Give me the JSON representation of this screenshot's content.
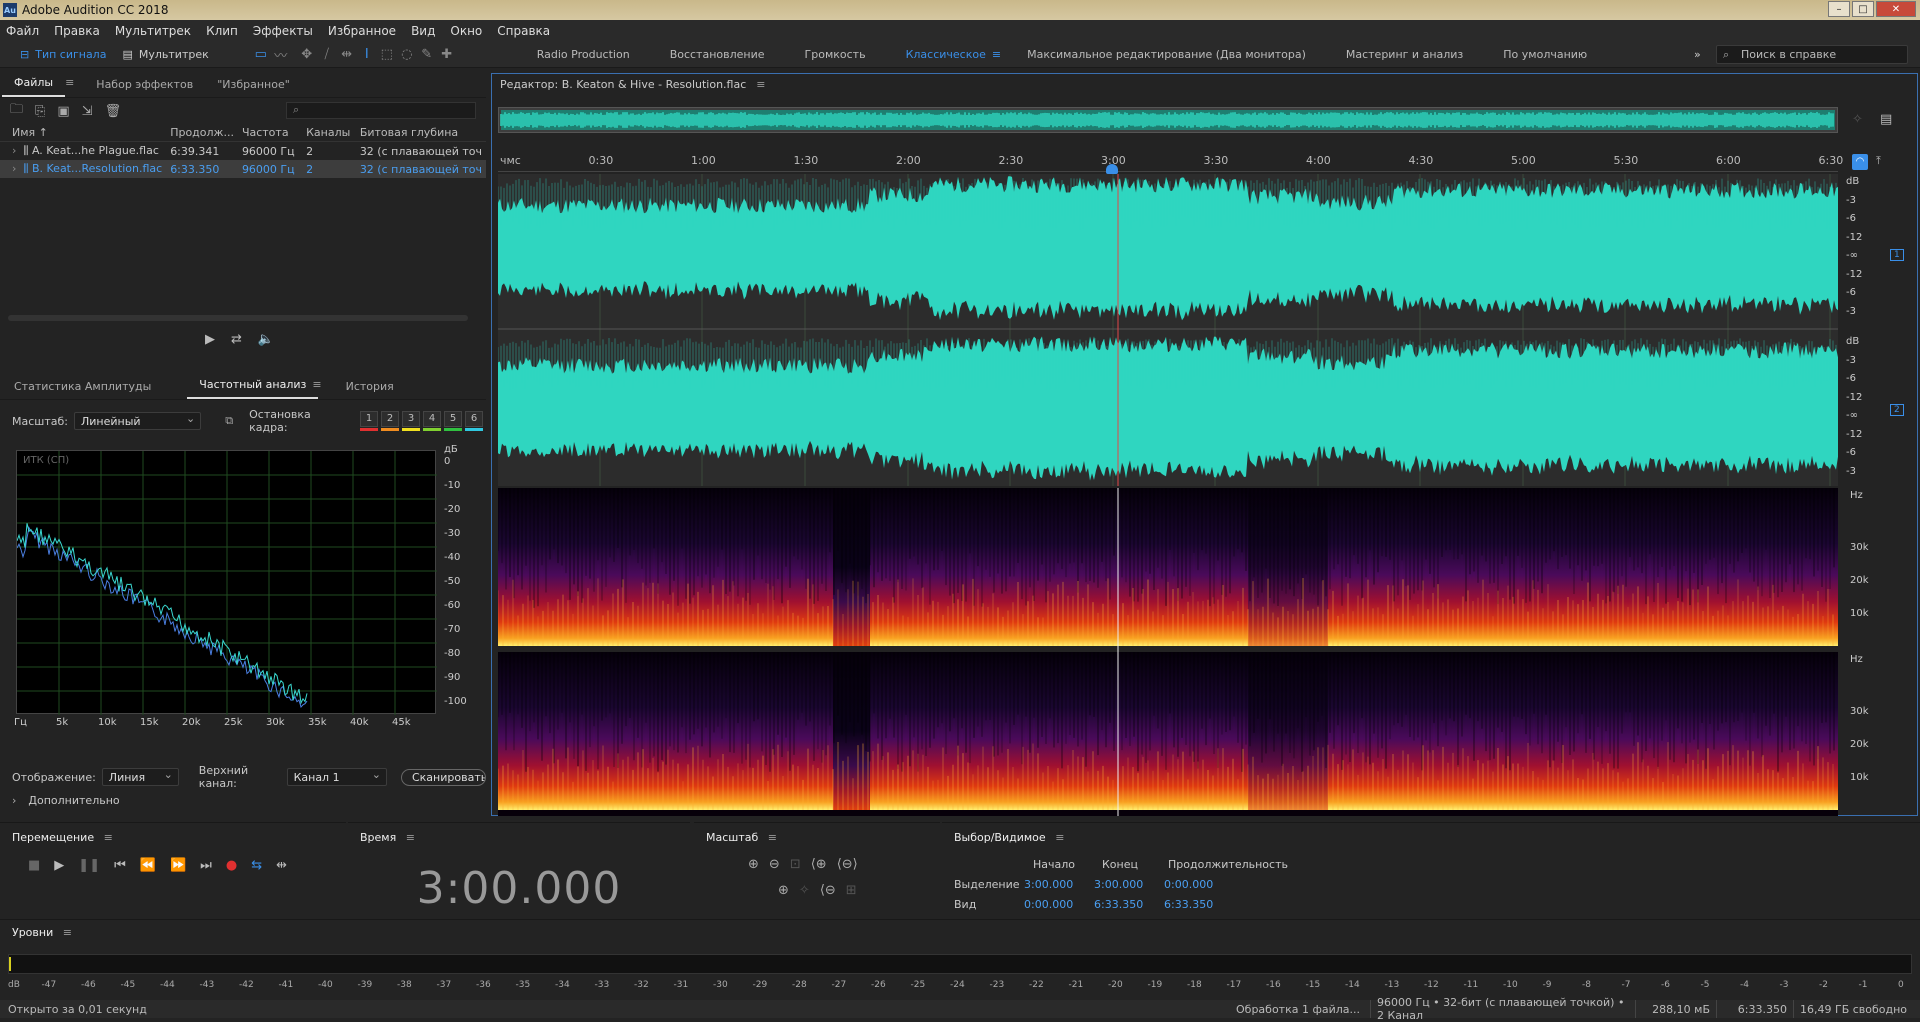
{
  "title": "Adobe Audition CC 2018",
  "menu": [
    "Файл",
    "Правка",
    "Мультитрек",
    "Клип",
    "Эффекты",
    "Избранное",
    "Вид",
    "Окно",
    "Справка"
  ],
  "modes": {
    "waveform": "Тип сигнала",
    "multitrack": "Мультитрек"
  },
  "workspaces": [
    "Radio Production",
    "Восстановление",
    "Громкость",
    "Классическое",
    "Максимальное редактирование (Два монитора)",
    "Мастеринг и анализ",
    "По умолчанию"
  ],
  "active_workspace": "Классическое",
  "help_search_placeholder": "Поиск в справке",
  "files_panel": {
    "tabs": [
      "Файлы",
      "Набор эффектов",
      "\"Избранное\""
    ],
    "columns": [
      "Имя",
      "Продолж...",
      "Частота",
      "Каналы",
      "Битовая глубина"
    ],
    "rows": [
      {
        "name": "A. Keat...he Plague.flac",
        "duration": "6:39.341",
        "rate": "96000 Гц",
        "channels": "2",
        "depth": "32 (с плавающей точ"
      },
      {
        "name": "B. Keat...Resolution.flac",
        "duration": "6:33.350",
        "rate": "96000 Гц",
        "channels": "2",
        "depth": "32 (с плавающей точ"
      }
    ]
  },
  "analysis_panel": {
    "tabs": [
      "Статистика Амплитуды",
      "Частотный анализ",
      "История"
    ],
    "scale_label": "Масштаб:",
    "scale_value": "Линейный",
    "freeze_label": "Остановка кадра:",
    "freeze_buttons": [
      "1",
      "2",
      "3",
      "4",
      "5",
      "6"
    ],
    "freeze_colors": [
      "#e03030",
      "#f08c20",
      "#f0e020",
      "#80d030",
      "#30c040",
      "#30c8e0"
    ],
    "graph_label": "ИТК (СП)",
    "db_unit": "дБ",
    "db_ticks": [
      "0",
      "-10",
      "-20",
      "-30",
      "-40",
      "-50",
      "-60",
      "-70",
      "-80",
      "-90",
      "-100"
    ],
    "hz_ticks": [
      "Гц",
      "5k",
      "10k",
      "15k",
      "20k",
      "25k",
      "30k",
      "35k",
      "40k",
      "45k"
    ],
    "display_label": "Отображение:",
    "display_value": "Линия",
    "channel_label": "Верхний канал:",
    "channel_value": "Канал 1",
    "scan_button": "Сканировать",
    "advanced": "Дополнительно"
  },
  "editor": {
    "title": "Редактор: B. Keaton & Hive - Resolution.flac",
    "time_ticks": [
      "чмс",
      "0:30",
      "1:00",
      "1:30",
      "2:00",
      "2:30",
      "3:00",
      "3:30",
      "4:00",
      "4:30",
      "5:00",
      "5:30",
      "6:00",
      "6:30"
    ],
    "db_ticks_ch": [
      "dB",
      "-3",
      "-6",
      "-12",
      "-∞",
      "-12",
      "-6",
      "-3"
    ],
    "channels": [
      "1",
      "2"
    ],
    "hz_label": "Hz",
    "hz_ticks": [
      "30k",
      "20k",
      "10k"
    ]
  },
  "transport": {
    "title": "Перемещение"
  },
  "time": {
    "title": "Время",
    "value": "3:00.000"
  },
  "zoom": {
    "title": "Масштаб"
  },
  "selection": {
    "title": "Выбор/Видимое",
    "headers": [
      "Начало",
      "Конец",
      "Продолжительность"
    ],
    "rows": [
      {
        "label": "Выделение",
        "start": "3:00.000",
        "end": "3:00.000",
        "duration": "0:00.000"
      },
      {
        "label": "Вид",
        "start": "0:00.000",
        "end": "6:33.350",
        "duration": "6:33.350"
      }
    ]
  },
  "levels": {
    "title": "Уровни",
    "ticks": [
      "dB",
      "-47",
      "-46",
      "-45",
      "-44",
      "-43",
      "-42",
      "-41",
      "-40",
      "-39",
      "-38",
      "-37",
      "-36",
      "-35",
      "-34",
      "-33",
      "-32",
      "-31",
      "-30",
      "-29",
      "-28",
      "-27",
      "-26",
      "-25",
      "-24",
      "-23",
      "-22",
      "-21",
      "-20",
      "-19",
      "-18",
      "-17",
      "-16",
      "-15",
      "-14",
      "-13",
      "-12",
      "-11",
      "-10",
      "-9",
      "-8",
      "-7",
      "-6",
      "-5",
      "-4",
      "-3",
      "-2",
      "-1",
      "0"
    ]
  },
  "status": {
    "left": "Открыто за 0,01 секунд",
    "processing": "Обработка 1 файла...",
    "format": "96000 Гц • 32-бит (с плавающей точкой) • 2 Канал",
    "size": "288,10 мБ",
    "duration": "6:33.350",
    "free": "16,49 ГБ свободно"
  },
  "colors": {
    "accent": "#3a8fe8",
    "waveform": "#2fd6c0",
    "playhead": "#e04848"
  }
}
